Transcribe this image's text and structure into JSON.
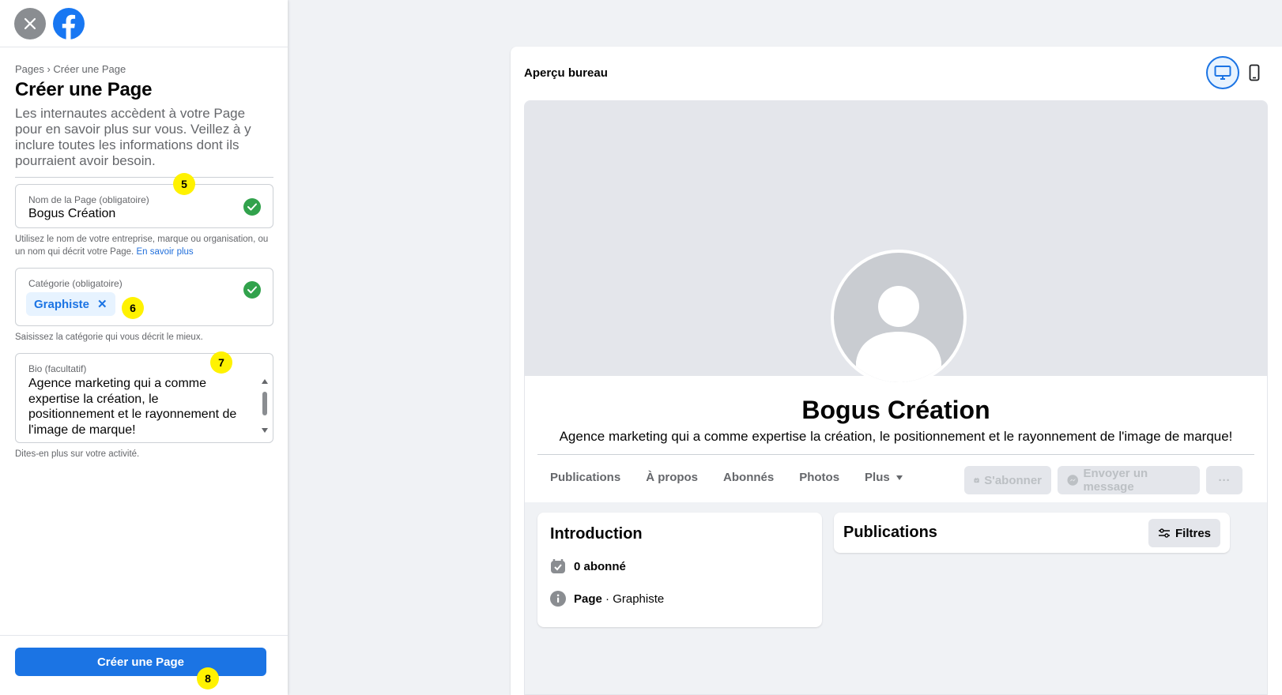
{
  "sidebar": {
    "breadcrumb": "Pages › Créer une Page",
    "title": "Créer une Page",
    "intro": "Les internautes accèdent à votre Page pour en savoir plus sur vous. Veillez à y inclure toutes les informations dont ils pourraient avoir besoin.",
    "name_field": {
      "label": "Nom de la Page (obligatoire)",
      "value": "Bogus Création",
      "helper": "Utilisez le nom de votre entreprise, marque ou organisation, ou un nom qui décrit votre Page.",
      "helper_link": "En savoir plus"
    },
    "category_field": {
      "label": "Catégorie (obligatoire)",
      "chip": "Graphiste",
      "chip_remove": "✕",
      "helper": "Saisissez la catégorie qui vous décrit le mieux."
    },
    "bio_field": {
      "label": "Bio (facultatif)",
      "value": "Agence marketing qui a comme expertise la création, le positionnement et le rayonnement de l'image de marque!",
      "helper": "Dites-en plus sur votre activité."
    },
    "create_button": "Créer une Page",
    "markers": [
      "5",
      "6",
      "7",
      "8"
    ]
  },
  "preview": {
    "title": "Aperçu bureau",
    "page_name": "Bogus Création",
    "page_bio": "Agence marketing qui a comme expertise la création, le positionnement et le rayonnement de l'image de marque!",
    "tabs": [
      "Publications",
      "À propos",
      "Abonnés",
      "Photos",
      "Plus"
    ],
    "actions": {
      "subscribe": "S'abonner",
      "message": "Envoyer un message",
      "more": "···"
    },
    "intro_card": {
      "title": "Introduction",
      "followers": "0 abonné",
      "page_label": "Page",
      "page_category": " · Graphiste"
    },
    "publications_card": {
      "title": "Publications",
      "filter": "Filtres"
    }
  },
  "colors": {
    "accent": "#1b74e4",
    "success": "#31a24c",
    "marker": "#fff200"
  }
}
